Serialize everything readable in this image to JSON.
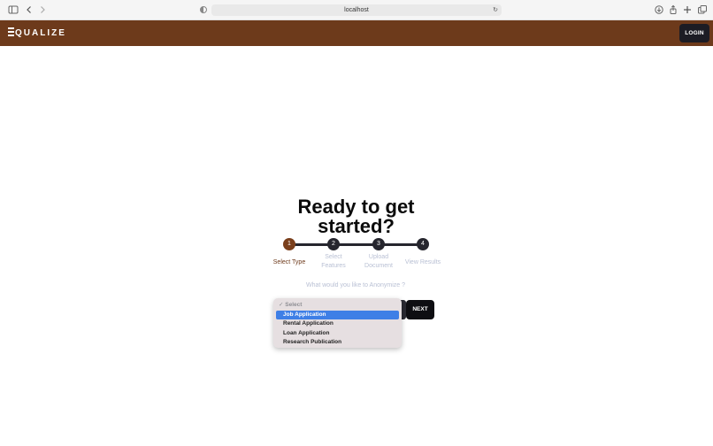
{
  "browser": {
    "url": "localhost"
  },
  "header": {
    "logo_text": "QUALIZE",
    "login_label": "LOGIN",
    "bg_color": "#6d3a1b"
  },
  "main": {
    "headline_line1": "Ready to get",
    "headline_line2": "started?",
    "steps": [
      {
        "number": "1",
        "label": "Select Type",
        "active": true
      },
      {
        "number": "2",
        "label": "Select Features",
        "active": false
      },
      {
        "number": "3",
        "label": "Upload Document",
        "active": false
      },
      {
        "number": "4",
        "label": "View Results",
        "active": false
      }
    ],
    "question": "What would you like to Anonymize ?",
    "dropdown": {
      "placeholder": "Select",
      "options": [
        "Job Application",
        "Rental Application",
        "Loan Application",
        "Research Publication"
      ],
      "highlighted": "Job Application"
    },
    "next_label": "NEXT"
  }
}
